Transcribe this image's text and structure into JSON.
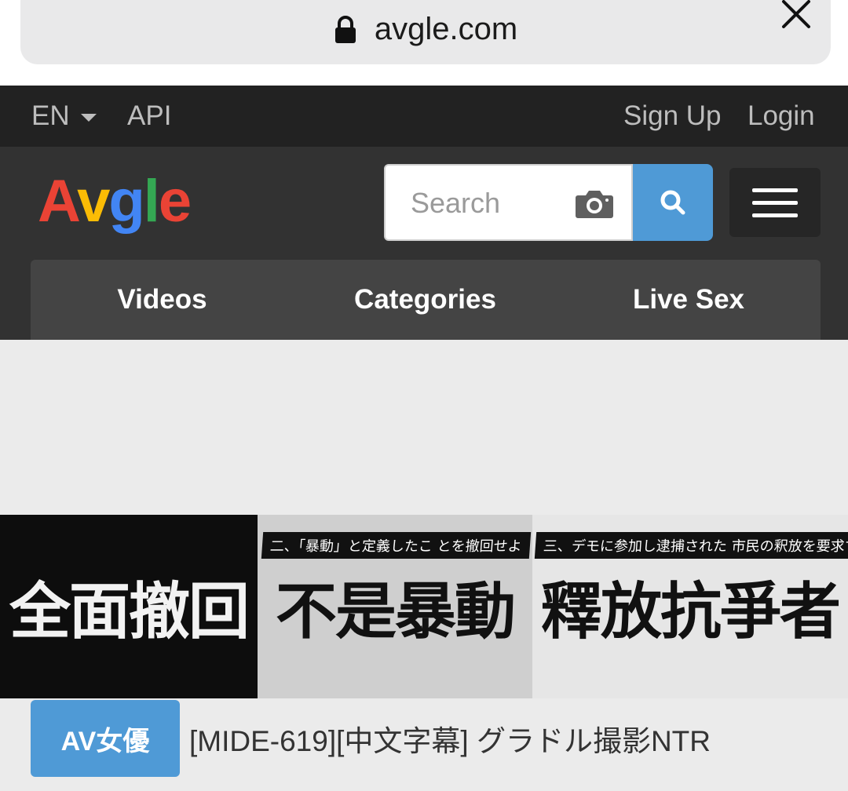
{
  "browser": {
    "url": "avgle.com"
  },
  "topbar": {
    "language": "EN",
    "api": "API",
    "signup": "Sign Up",
    "login": "Login"
  },
  "header": {
    "logo_letters": [
      {
        "char": "A",
        "color": "#ea4335"
      },
      {
        "char": "v",
        "color": "#fbbc05"
      },
      {
        "char": "g",
        "color": "#4285f4"
      },
      {
        "char": "l",
        "color": "#34a853"
      },
      {
        "char": "e",
        "color": "#ea4335"
      }
    ],
    "search_placeholder": "Search"
  },
  "nav": {
    "videos": "Videos",
    "categories": "Categories",
    "live_sex": "Live Sex"
  },
  "thumbnail": {
    "panels": [
      {
        "headline": "全面撤回",
        "caption": "",
        "bg": "#0d0d0d",
        "fg": "#f2f2f2"
      },
      {
        "headline": "不是暴動",
        "caption": "二、「暴動」と定義したこ とを撤回せよ",
        "bg": "#cfcfcf",
        "fg": "#111111"
      },
      {
        "headline": "釋放抗爭者",
        "caption": "三、デモに参加し逮捕された 市民の釈放を要求する",
        "bg": "#e6e6e6",
        "fg": "#111111"
      }
    ]
  },
  "video": {
    "tag": "AV女優",
    "title": "[MIDE-619][中文字幕] グラドル撮影NTR"
  },
  "colors": {
    "accent": "#4f9ad6",
    "topbar": "#222222",
    "header": "#323232",
    "nav": "#444444"
  }
}
